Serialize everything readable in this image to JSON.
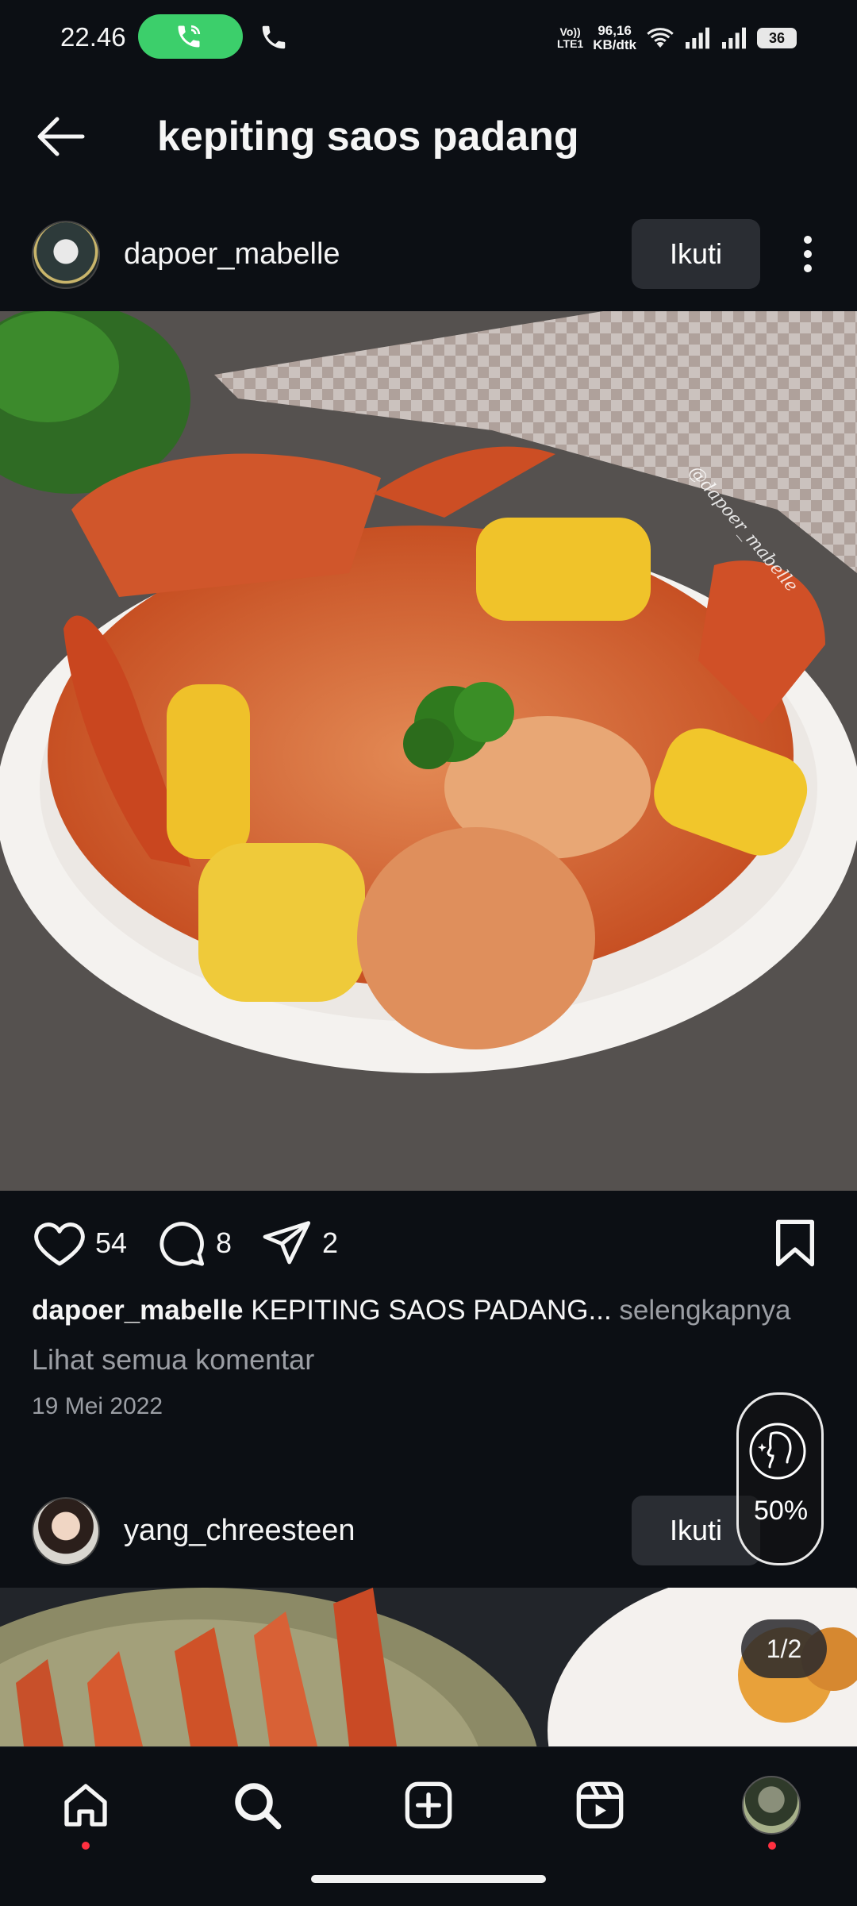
{
  "status_bar": {
    "time": "22.46",
    "network_label_top": "Vo))",
    "network_label_bottom": "LTE1",
    "speed_value": "96,16",
    "speed_unit": "KB/dtk",
    "battery": "36"
  },
  "header": {
    "title": "kepiting saos padang"
  },
  "post": {
    "username": "dapoer_mabelle",
    "follow_label": "Ikuti",
    "image_watermark": "@dapoer_mabelle",
    "likes": "54",
    "comments": "8",
    "shares": "2",
    "caption_user": "dapoer_mabelle",
    "caption_text": "KEPITING SAOS PADANG...",
    "caption_more": "selengkapnya",
    "view_comments": "Lihat semua komentar",
    "date": "19 Mei 2022"
  },
  "next_post": {
    "username": "yang_chreesteen",
    "follow_label": "Ikuti",
    "page_counter": "1/2"
  },
  "floating_widget": {
    "percent": "50%"
  },
  "bottom_nav": {
    "items": [
      "home-icon",
      "search-icon",
      "create-icon",
      "reels-icon",
      "profile-avatar"
    ],
    "notification_color": "#ff3040"
  }
}
